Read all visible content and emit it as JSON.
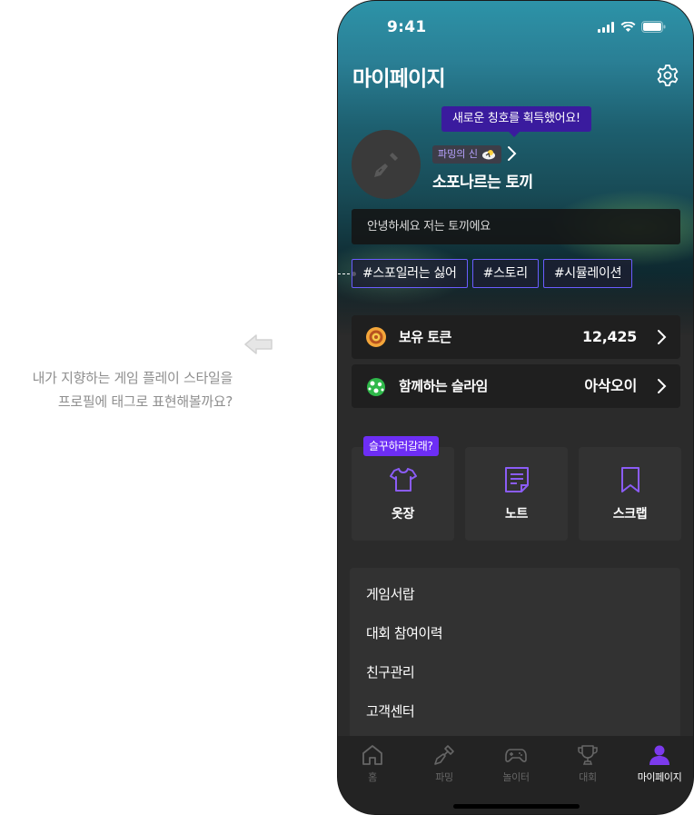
{
  "annotation": {
    "lines": [
      "내가 지향하는 게임 플레이 스타일을",
      "프로필에 태그로 표현해볼까요?"
    ]
  },
  "status_bar": {
    "time": "9:41"
  },
  "header": {
    "title": "마이페이지"
  },
  "profile": {
    "tooltip": "새로운 칭호를 획득했어요!",
    "title_badge": "파밍의 신",
    "nickname": "소포나르는 토끼",
    "bio": "안녕하세요 저는 토끼에요",
    "tags": [
      "#스포일러는 싫어",
      "#스토리",
      "#시뮬레이션"
    ]
  },
  "rows": [
    {
      "label": "보유 토큰",
      "value": "12,425",
      "icon": "token-coin-icon"
    },
    {
      "label": "함께하는 슬라임",
      "value": "아삭오이",
      "icon": "slime-icon"
    }
  ],
  "menu_cards": {
    "bubble": "슬꾸하러갈래?",
    "items": [
      {
        "label": "옷장",
        "icon": "shirt-icon"
      },
      {
        "label": "노트",
        "icon": "note-icon"
      },
      {
        "label": "스크랩",
        "icon": "bookmark-icon"
      }
    ]
  },
  "list": [
    "게임서랍",
    "대회 참여이력",
    "친구관리",
    "고객센터"
  ],
  "tabbar": [
    {
      "label": "홈",
      "icon": "home-icon",
      "active": false
    },
    {
      "label": "파밍",
      "icon": "shovel-icon",
      "active": false
    },
    {
      "label": "놀이터",
      "icon": "gamepad-icon",
      "active": false
    },
    {
      "label": "대회",
      "icon": "trophy-icon",
      "active": false
    },
    {
      "label": "마이페이지",
      "icon": "person-icon",
      "active": true
    }
  ],
  "colors": {
    "accent": "#6d2ef5",
    "tooltip_bg": "#3a1b9e",
    "tag_border": "#6b5cff",
    "app_bg": "#2b2b2b"
  }
}
